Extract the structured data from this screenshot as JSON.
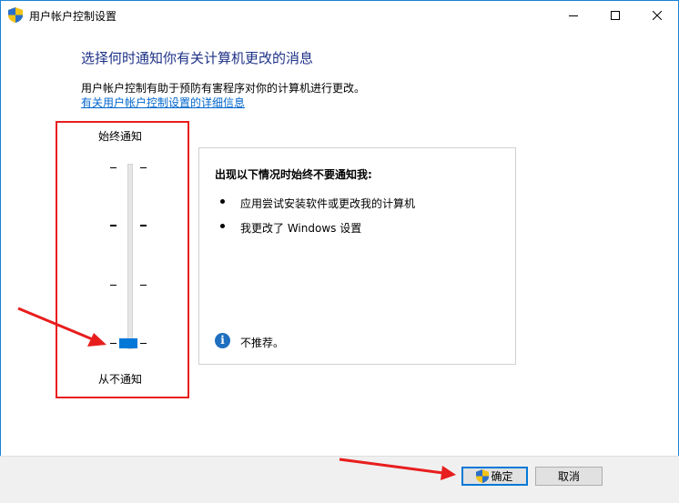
{
  "window": {
    "title": "用户帐户控制设置",
    "controls": {
      "minimize": "minimize-icon",
      "maximize": "maximize-icon",
      "close": "close-icon"
    }
  },
  "main": {
    "heading": "选择何时通知你有关计算机更改的消息",
    "description": "用户帐户控制有助于预防有害程序对你的计算机进行更改。",
    "more_info_link": "有关用户帐户控制设置的详细信息"
  },
  "slider": {
    "top_label": "始终通知",
    "bottom_label": "从不通知",
    "levels": 4,
    "selected_level": 1
  },
  "info_panel": {
    "title": "出现以下情况时始终不要通知我:",
    "bullets": [
      "应用尝试安装软件或更改我的计算机",
      "我更改了 Windows 设置"
    ],
    "note": "不推荐。",
    "note_icon": "info-icon"
  },
  "buttons": {
    "ok": "确定",
    "cancel": "取消"
  },
  "colors": {
    "accent": "#0078d7",
    "heading": "#1e3287",
    "link": "#0066cc",
    "annotation": "#e81e1e"
  }
}
